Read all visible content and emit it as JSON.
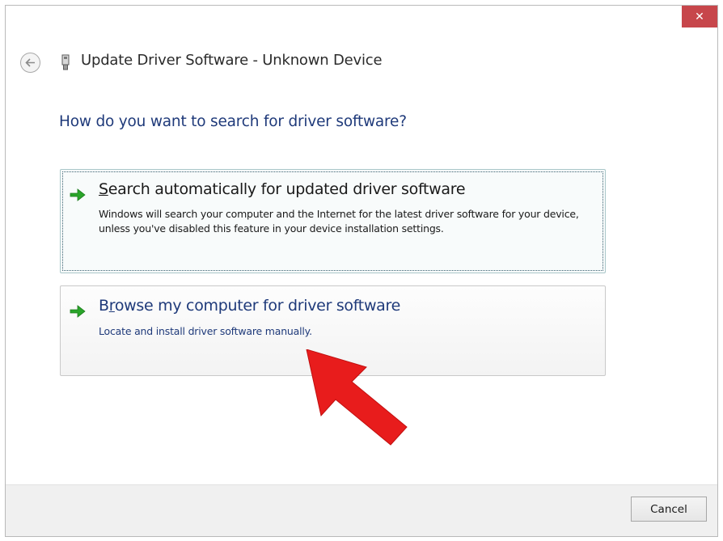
{
  "window": {
    "title": "Update Driver Software - Unknown Device",
    "close_glyph": "✕"
  },
  "content": {
    "question": "How do you want to search for driver software?",
    "options": [
      {
        "title_first_char": "S",
        "title_rest": "earch automatically for updated driver software",
        "description": "Windows will search your computer and the Internet for the latest driver software for your device, unless you've disabled this feature in your device installation settings.",
        "icon": "green-arrow-icon",
        "state": "focused"
      },
      {
        "title_first_char": "B",
        "title_underlined_char": "r",
        "title_rest": "owse my computer for driver software",
        "description": "Locate and install driver software manually.",
        "icon": "green-arrow-icon",
        "state": "hover"
      }
    ]
  },
  "footer": {
    "cancel_label": "Cancel"
  },
  "colors": {
    "accent_blue": "#1f3a7a",
    "close_red": "#c7464b",
    "arrow_green": "#2aa52a",
    "annotation_red": "#e81c1c"
  }
}
